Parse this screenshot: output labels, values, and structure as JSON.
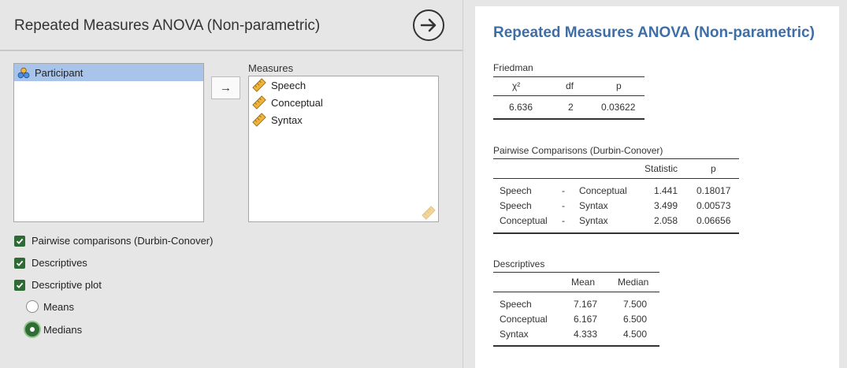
{
  "left_panel": {
    "title": "Repeated Measures ANOVA (Non-parametric)",
    "variables": [
      {
        "label": "Participant",
        "icon": "nominal-variable-icon"
      }
    ],
    "measures_label": "Measures",
    "measures": [
      {
        "label": "Speech",
        "icon": "ruler-icon"
      },
      {
        "label": "Conceptual",
        "icon": "ruler-icon"
      },
      {
        "label": "Syntax",
        "icon": "ruler-icon"
      }
    ],
    "move_button": "→",
    "options": {
      "pairwise": {
        "label": "Pairwise comparisons (Durbin-Conover)",
        "checked": true
      },
      "descriptives": {
        "label": "Descriptives",
        "checked": true
      },
      "descriptive_plot": {
        "label": "Descriptive plot",
        "checked": true
      },
      "means": {
        "label": "Means",
        "selected": false
      },
      "medians": {
        "label": "Medians",
        "selected": true
      }
    },
    "colors": {
      "accent_green": "#2e6b34",
      "selection": "#a8c4ea"
    }
  },
  "results": {
    "title": "Repeated Measures ANOVA (Non-parametric)",
    "title_color": "#3e6ea8",
    "friedman": {
      "caption": "Friedman",
      "headers": [
        "χ²",
        "df",
        "p"
      ],
      "row": [
        "6.636",
        "2",
        "0.03622"
      ]
    },
    "pairwise": {
      "caption": "Pairwise Comparisons (Durbin-Conover)",
      "headers": [
        "Statistic",
        "p"
      ],
      "rows": [
        [
          "Speech",
          "-",
          "Conceptual",
          "1.441",
          "0.18017"
        ],
        [
          "Speech",
          "-",
          "Syntax",
          "3.499",
          "0.00573"
        ],
        [
          "Conceptual",
          "-",
          "Syntax",
          "2.058",
          "0.06656"
        ]
      ]
    },
    "descriptives": {
      "caption": "Descriptives",
      "headers": [
        "Mean",
        "Median"
      ],
      "rows": [
        [
          "Speech",
          "7.167",
          "7.500"
        ],
        [
          "Conceptual",
          "6.167",
          "6.500"
        ],
        [
          "Syntax",
          "4.333",
          "4.500"
        ]
      ]
    }
  }
}
